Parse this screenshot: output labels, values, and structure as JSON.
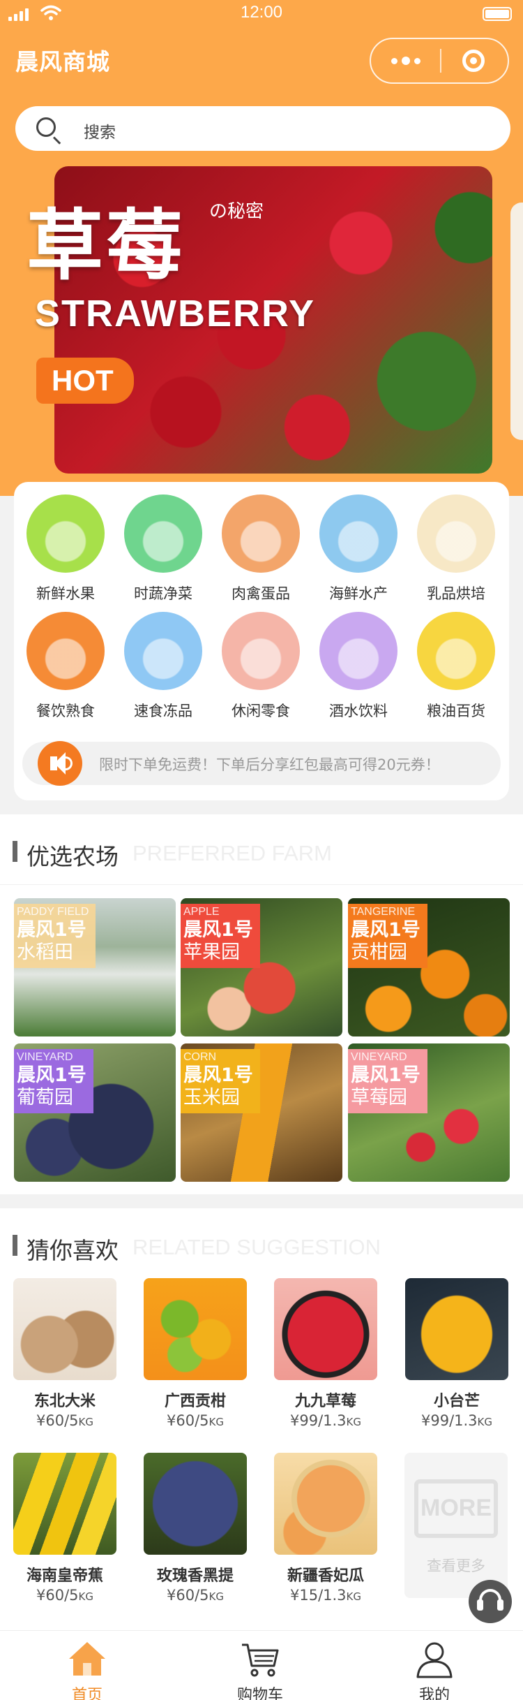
{
  "status_bar": {
    "time": "12:00"
  },
  "header": {
    "title": "晨风商城"
  },
  "search": {
    "placeholder": "搜索"
  },
  "banner": {
    "title": "草莓",
    "subtitle": "の秘密",
    "english": "STRAWBERRY",
    "badge": "HOT"
  },
  "categories": [
    {
      "label": "新鲜水果",
      "color": "#a7e04a"
    },
    {
      "label": "时蔬净菜",
      "color": "#6fd58e"
    },
    {
      "label": "肉禽蛋品",
      "color": "#f3a56a"
    },
    {
      "label": "海鲜水产",
      "color": "#8ec9ef"
    },
    {
      "label": "乳品烘培",
      "color": "#f7e8c6"
    },
    {
      "label": "餐饮熟食",
      "color": "#f58b36"
    },
    {
      "label": "速食冻品",
      "color": "#8fc8f4"
    },
    {
      "label": "休闲零食",
      "color": "#f5b5a8"
    },
    {
      "label": "酒水饮料",
      "color": "#c9a8f0"
    },
    {
      "label": "粮油百货",
      "color": "#f7d640"
    }
  ],
  "notice": {
    "text": "限时下单免运费！下单后分享红包最高可得20元券！"
  },
  "farm_section": {
    "title_cn": "优选农场",
    "title_en": "PREFERRED FARM",
    "farms": [
      {
        "en": "PADDY FIELD",
        "name": "晨风1号",
        "sub": "水稻田",
        "tag_color": "rgba(248,214,150,0.9)",
        "bg": "linear-gradient(180deg,#c9d4d0 0%,#9db39a 35%,#e3e7e2 55%,#4b7c36 100%)"
      },
      {
        "en": "APPLE",
        "name": "晨风1号",
        "sub": "苹果园",
        "tag_color": "#ef4b3c",
        "bg": "radial-gradient(circle at 55% 65%,#e24a3a 0 36px,transparent 38px),radial-gradient(circle at 30% 80%,#f2c2a0 0 30px,transparent 32px),linear-gradient(160deg,#2f4a22,#6b8d3a 60%,#34502a)"
      },
      {
        "en": "TANGERINE",
        "name": "晨风1号",
        "sub": "贡柑园",
        "tag_color": "#f47a1d",
        "bg": "radial-gradient(circle at 60% 55%,#f08a12 0 34px,transparent 36px),radial-gradient(circle at 25% 80%,#f59a1a 0 32px,transparent 34px),radial-gradient(circle at 85% 85%,#e67e10 0 30px,transparent 32px),linear-gradient(160deg,#1f3514,#3d5a22)"
      },
      {
        "en": "VINEYARD",
        "name": "晨风1号",
        "sub": "葡萄园",
        "tag_color": "#9b6ae0",
        "bg": "radial-gradient(circle at 60% 60%,#2a3154 0 60px,transparent 62px),radial-gradient(circle at 25% 75%,#343b66 0 40px,transparent 42px),linear-gradient(160deg,#8fa36a,#3f5a2b)"
      },
      {
        "en": "CORN",
        "name": "晨风1号",
        "sub": "玉米园",
        "tag_color": "#f2b21b",
        "bg": "linear-gradient(100deg,transparent 40%,#f2a21b 40% 60%,transparent 60%),linear-gradient(160deg,#6a4a22,#b98a45 50%,#5a3c1a)"
      },
      {
        "en": "VINEYARD",
        "name": "晨风1号",
        "sub": "草莓园",
        "tag_color": "#f59aa0",
        "bg": "radial-gradient(circle at 70% 60%,#e23040 0 24px,transparent 26px),radial-gradient(circle at 45% 75%,#d82a38 0 20px,transparent 22px),linear-gradient(160deg,#2f5a24,#7aa24a 55%,#4a7a32)"
      }
    ]
  },
  "suggest_section": {
    "title_cn": "猜你喜欢",
    "title_en": "RELATED SUGGESTION",
    "products": [
      {
        "name": "东北大米",
        "price": "¥60/5",
        "unit": "KG",
        "bg": "radial-gradient(circle at 35% 65%,#c9a27a 0 40px,transparent 42px),radial-gradient(circle at 70% 60%,#b88c60 0 40px,transparent 42px),linear-gradient(180deg,#f3ece4,#e8dccd)"
      },
      {
        "name": "广西贡柑",
        "price": "¥60/5",
        "unit": "KG",
        "bg": "radial-gradient(circle at 35% 40%,#7bb82a 0 26px,transparent 28px),radial-gradient(circle at 65% 60%,#f2b01a 0 28px,transparent 30px),radial-gradient(circle at 40% 75%,#8cc43a 0 24px,transparent 26px),linear-gradient(180deg,#f6a21a,#f4901a)"
      },
      {
        "name": "九九草莓",
        "price": "¥99/1.3",
        "unit": "KG",
        "bg": "radial-gradient(circle at 50% 55%,#d92435 0 54px,#222 55px 62px,transparent 63px),linear-gradient(180deg,#f4b7b0,#ef9a92)"
      },
      {
        "name": "小台芒",
        "price": "¥99/1.3",
        "unit": "KG",
        "bg": "radial-gradient(ellipse at 50% 55%,#f5b41a 0 50px,transparent 52px),linear-gradient(160deg,#1e2a36,#3a4650)"
      },
      {
        "name": "海南皇帝蕉",
        "price": "¥60/5",
        "unit": "KG",
        "bg": "linear-gradient(110deg,transparent 20%,#f5cf1a 20% 38%,transparent 38% 45%,#f0c410 45% 62%,transparent 62% 68%,#f5d42a 68% 85%,transparent 85%),linear-gradient(180deg,#7c9b3a,#3f5a22)"
      },
      {
        "name": "玫瑰香黑提",
        "price": "¥60/5",
        "unit": "KG",
        "bg": "radial-gradient(circle at 50% 50%,#3e4a82 0 60px,transparent 62px),linear-gradient(180deg,#4a6a2a,#2c3a1a)"
      },
      {
        "name": "新疆香妃瓜",
        "price": "¥15/1.3",
        "unit": "KG",
        "bg": "radial-gradient(ellipse at 55% 45%,#f2a45a 0 48px,#e8c98a 49px 56px,transparent 57px),radial-gradient(ellipse at 30% 78%,#f0a050 0 30px,transparent 32px),linear-gradient(180deg,#f7dca8,#eac27a)"
      }
    ],
    "more_box": "MORE",
    "more_label": "查看更多"
  },
  "tabbar": {
    "tabs": [
      {
        "label": "首页",
        "icon": "home-icon",
        "active": true
      },
      {
        "label": "购物车",
        "icon": "cart-icon",
        "active": false
      },
      {
        "label": "我的",
        "icon": "user-icon",
        "active": false
      }
    ]
  },
  "colors": {
    "brand_orange": "#fda84a",
    "active_tab": "#f08a24"
  }
}
